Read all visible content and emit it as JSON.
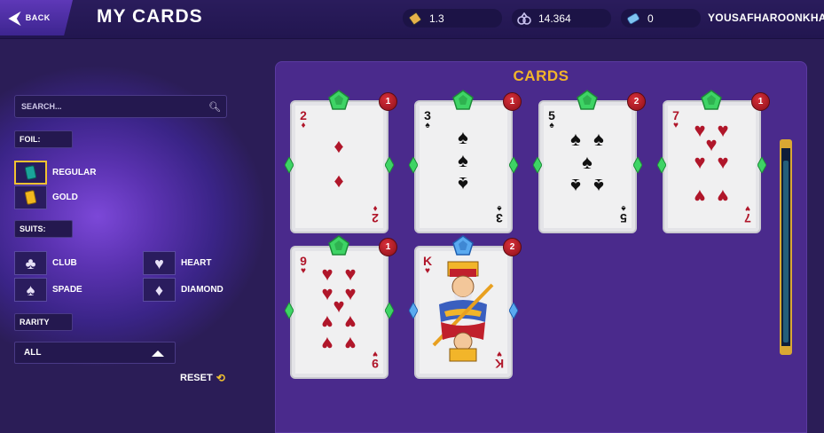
{
  "header": {
    "back_label": "BACK",
    "title": "MY CARDS",
    "stats": [
      {
        "icon": "ticket-icon",
        "value": "1.3"
      },
      {
        "icon": "currency-icon",
        "value": "14.364"
      },
      {
        "icon": "gem-ticket-icon",
        "value": "0"
      }
    ],
    "username": "YOUSAFHAROONKHAN"
  },
  "sidebar": {
    "search_placeholder": "SEARCH...",
    "foil_label": "FOIL:",
    "foil_options": [
      {
        "label": "REGULAR",
        "selected": true,
        "color": "#1aa39a"
      },
      {
        "label": "GOLD",
        "selected": false,
        "color": "#f2b81e"
      }
    ],
    "suits_label": "SUITS:",
    "suit_options": [
      {
        "label": "CLUB",
        "glyph": "♣"
      },
      {
        "label": "HEART",
        "glyph": "♥"
      },
      {
        "label": "SPADE",
        "glyph": "♠"
      },
      {
        "label": "DIAMOND",
        "glyph": "♦"
      }
    ],
    "rarity_label": "RARITY",
    "rarity_value": "ALL",
    "reset_label": "RESET"
  },
  "panel": {
    "title": "CARDS",
    "cards": [
      {
        "rank": "2",
        "suit": "♦",
        "color": "red",
        "count": "1",
        "gem": "green"
      },
      {
        "rank": "3",
        "suit": "♠",
        "color": "black",
        "count": "1",
        "gem": "green"
      },
      {
        "rank": "5",
        "suit": "♠",
        "color": "black",
        "count": "2",
        "gem": "green"
      },
      {
        "rank": "7",
        "suit": "♥",
        "color": "red",
        "count": "1",
        "gem": "green"
      },
      {
        "rank": "9",
        "suit": "♥",
        "color": "red",
        "count": "1",
        "gem": "green"
      },
      {
        "rank": "K",
        "suit": "♥",
        "color": "red",
        "count": "2",
        "gem": "blue"
      }
    ]
  },
  "colors": {
    "accent_gold": "#f2b52a",
    "count_badge": "#c0202c",
    "gem_green": "#2fb54a",
    "gem_blue": "#3a8ee0"
  }
}
